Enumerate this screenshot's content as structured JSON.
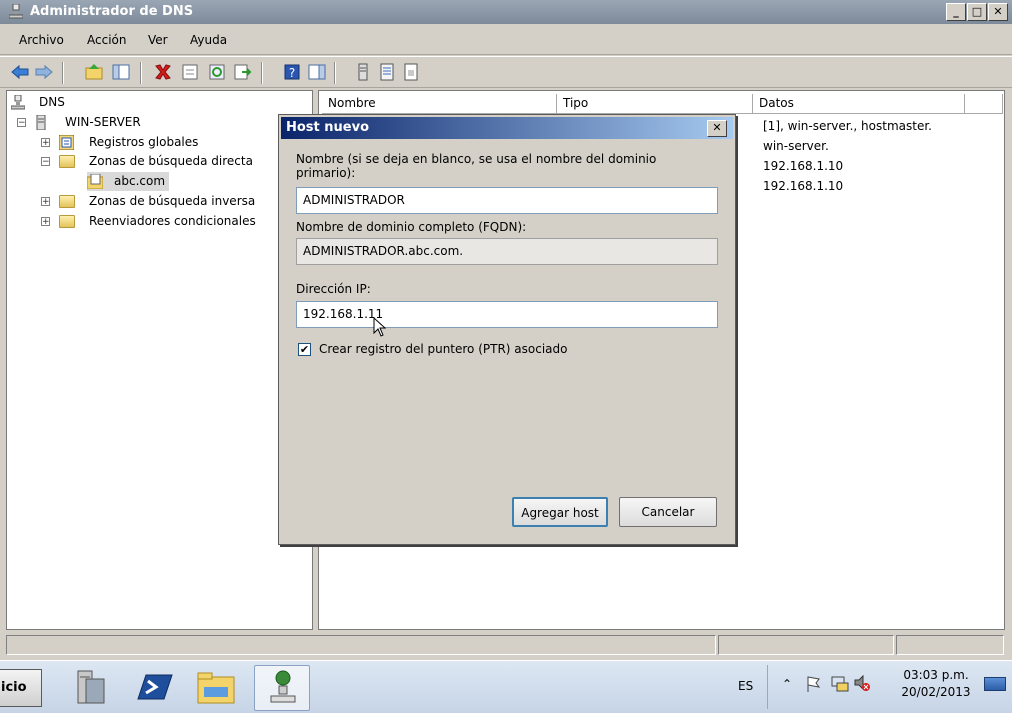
{
  "window": {
    "title": "Administrador de DNS",
    "caption_buttons": [
      "_",
      "□",
      "✕"
    ]
  },
  "menu": {
    "items": [
      "Archivo",
      "Acción",
      "Ver",
      "Ayuda"
    ]
  },
  "tree": {
    "root": "DNS",
    "server": "WIN-SERVER",
    "nodes": [
      "Registros globales",
      "Zonas de búsqueda directa",
      "abc.com",
      "Zonas de búsqueda inversa",
      "Reenviadores condicionales"
    ]
  },
  "list": {
    "columns": [
      "Nombre",
      "Tipo",
      "Datos"
    ],
    "data_values": [
      "[1], win-server., hostmaster.",
      "win-server.",
      "192.168.1.10",
      "192.168.1.10"
    ]
  },
  "dialog": {
    "title": "Host nuevo",
    "name_label": "Nombre (si se deja en blanco, se usa el nombre del dominio primario):",
    "name_value": "ADMINISTRADOR",
    "fqdn_label": "Nombre de dominio completo (FQDN):",
    "fqdn_value": "ADMINISTRADOR.abc.com.",
    "ip_label": "Dirección IP:",
    "ip_value": "192.168.1.11",
    "ptr_label": "Crear registro del puntero (PTR) asociado",
    "ptr_checked": true,
    "add_button": "Agregar host",
    "cancel_button": "Cancelar"
  },
  "taskbar": {
    "start_label": "icio",
    "language": "ES",
    "time": "03:03 p.m.",
    "date": "20/02/2013"
  }
}
